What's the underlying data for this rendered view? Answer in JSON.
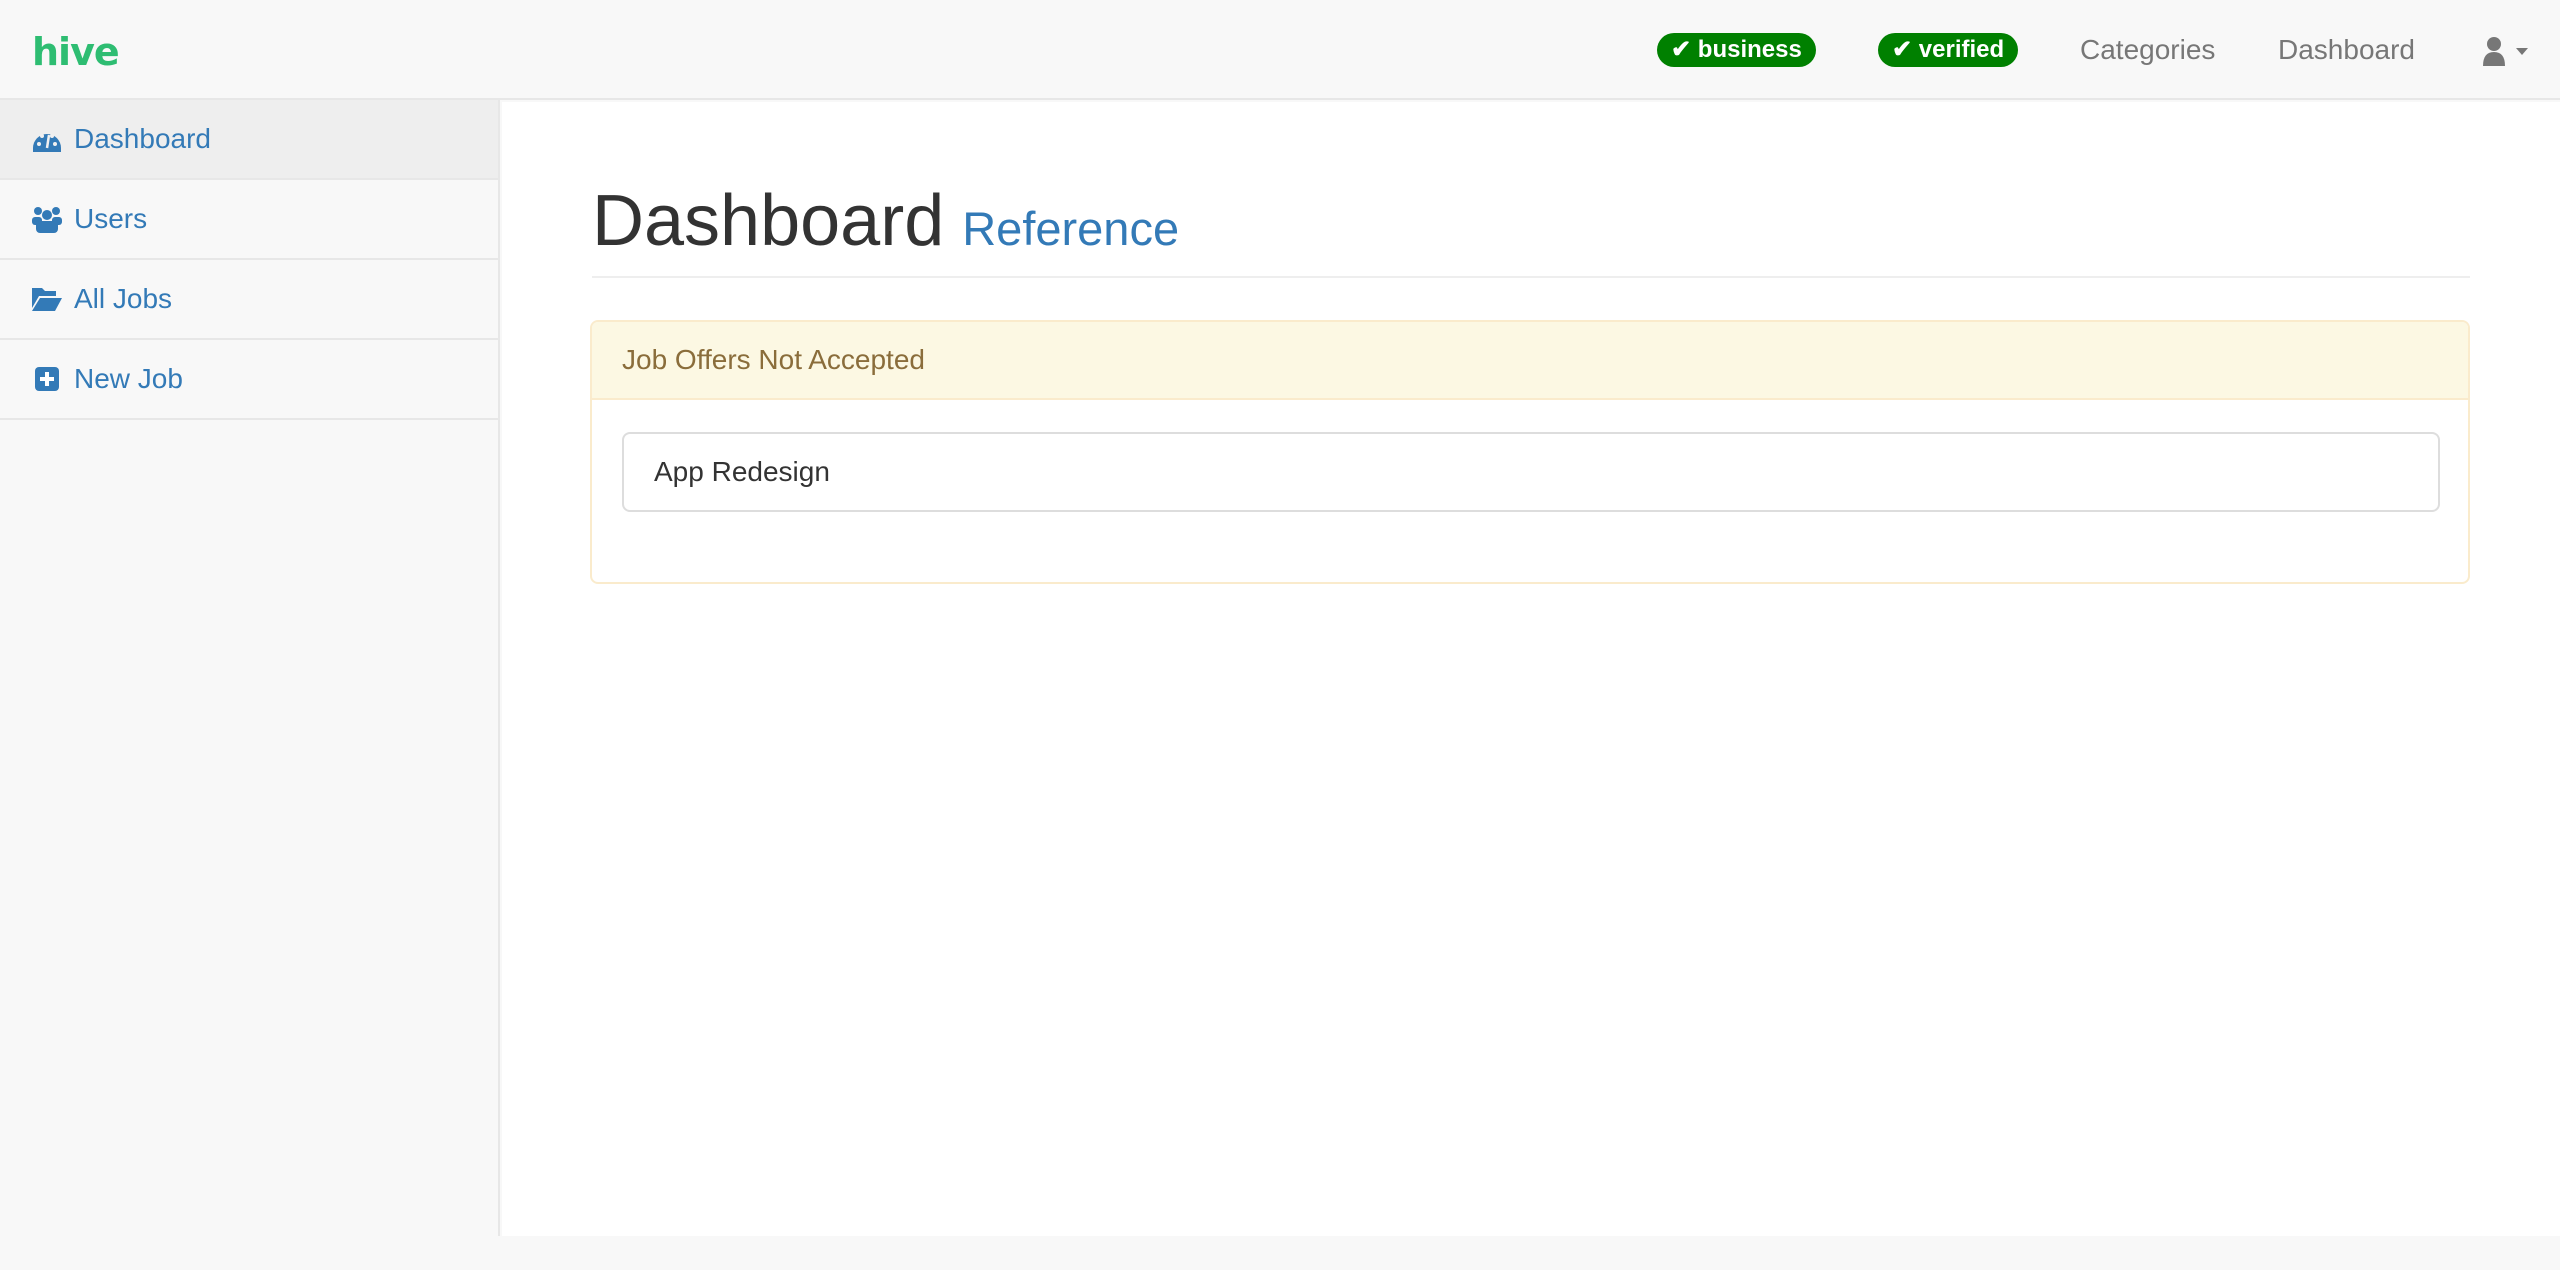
{
  "navbar": {
    "brand": "hive",
    "badges": [
      {
        "label": "business",
        "icon": "check-icon"
      },
      {
        "label": "verified",
        "icon": "check-icon"
      }
    ],
    "links": [
      "Categories",
      "Dashboard"
    ],
    "user_menu_icon": "user-icon",
    "badge_color": "#008000",
    "brand_color": "#2ebd72"
  },
  "sidebar": {
    "items": [
      {
        "label": "Dashboard",
        "icon": "tachometer-icon",
        "active": true
      },
      {
        "label": "Users",
        "icon": "users-icon"
      },
      {
        "label": "All Jobs",
        "icon": "folder-open-icon"
      },
      {
        "label": "New Job",
        "icon": "plus-square-icon"
      }
    ]
  },
  "main": {
    "title": "Dashboard",
    "subtitle": "Reference",
    "panel": {
      "heading": "Job Offers Not Accepted",
      "items": [
        "App Redesign"
      ]
    }
  }
}
